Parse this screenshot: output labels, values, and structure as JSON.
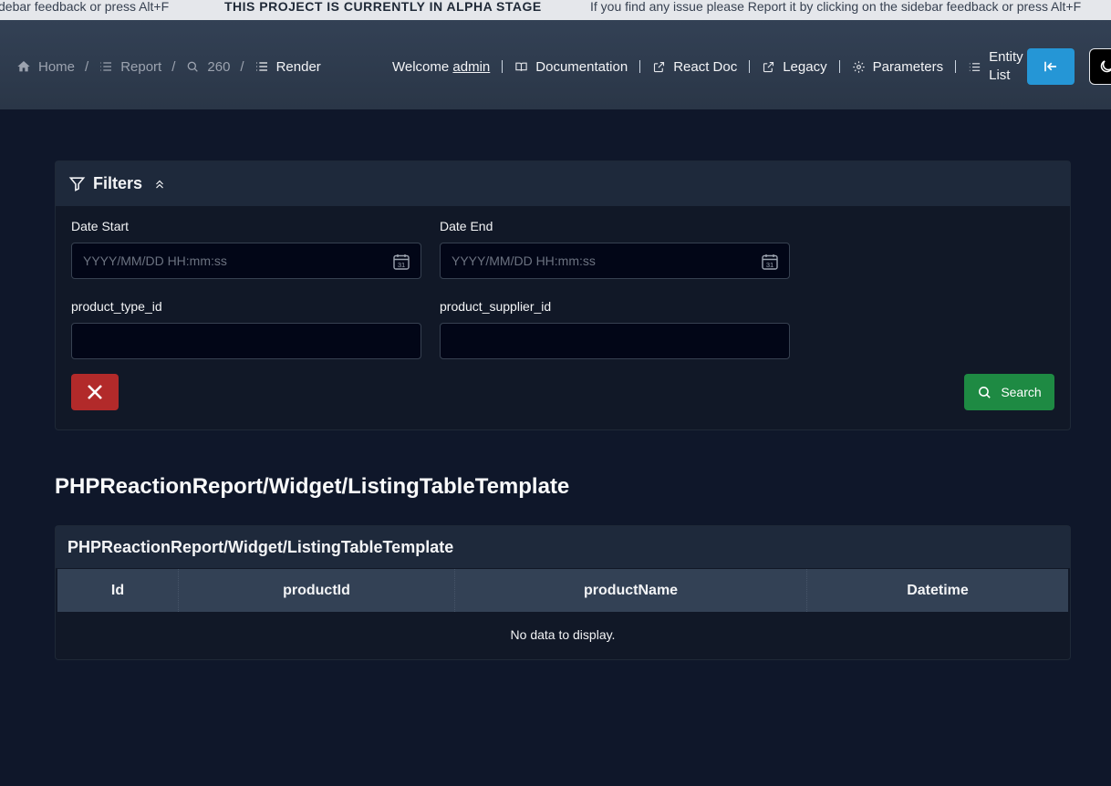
{
  "banner": {
    "left_text": "debar feedback or press Alt+F",
    "center_text": "THIS PROJECT IS CURRENTLY IN ALPHA STAGE",
    "right_text": "If you find any issue please Report it by clicking on the sidebar feedback or press Alt+F"
  },
  "breadcrumb": {
    "items": [
      {
        "label": "Home",
        "icon": "home-icon"
      },
      {
        "label": "Report",
        "icon": "list-icon"
      },
      {
        "label": "260",
        "icon": "search-icon"
      },
      {
        "label": "Render",
        "icon": "list-icon"
      }
    ],
    "separator": "/"
  },
  "topnav": {
    "welcome_prefix": "Welcome",
    "username": "admin",
    "links": [
      {
        "label": "Documentation",
        "icon": "book-icon"
      },
      {
        "label": "React Doc",
        "icon": "external-link-icon"
      },
      {
        "label": "Legacy",
        "icon": "external-link-icon"
      },
      {
        "label": "Parameters",
        "icon": "gear-icon"
      },
      {
        "label": "Entity List",
        "icon": "list-icon"
      }
    ]
  },
  "filters": {
    "title": "Filters",
    "date_start": {
      "label": "Date Start",
      "placeholder": "YYYY/MM/DD HH:mm:ss",
      "value": ""
    },
    "date_end": {
      "label": "Date End",
      "placeholder": "YYYY/MM/DD HH:mm:ss",
      "value": ""
    },
    "product_type_id": {
      "label": "product_type_id",
      "value": ""
    },
    "product_supplier_id": {
      "label": "product_supplier_id",
      "value": ""
    },
    "search_label": "Search"
  },
  "page_title": "PHPReactionReport/Widget/ListingTableTemplate",
  "table": {
    "title": "PHPReactionReport/Widget/ListingTableTemplate",
    "columns": [
      "Id",
      "productId",
      "productName",
      "Datetime"
    ],
    "empty_message": "No data to display."
  },
  "colors": {
    "background": "#0f172a",
    "header": "#334155",
    "primary_button": "#2596d6",
    "danger_button": "#b22a2a",
    "success_button": "#1e8a43"
  }
}
